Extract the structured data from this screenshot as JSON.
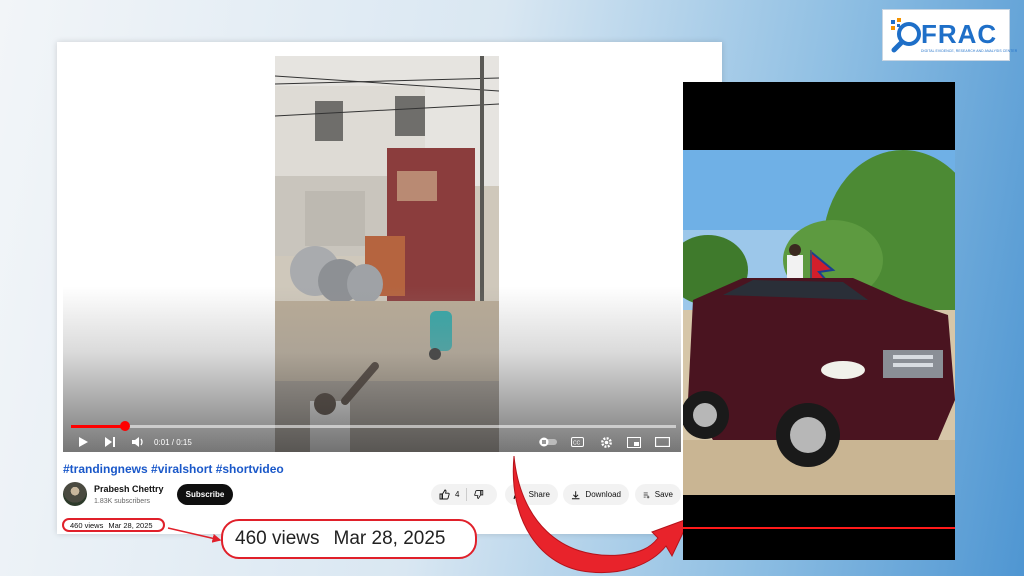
{
  "logo": {
    "text": "FRAC",
    "subtitle": "DIGITAL EVIDENCE, RESEARCH AND ANALYSIS CENTER"
  },
  "video": {
    "time": "0:01 / 0:15",
    "progress": 0.09,
    "tags": "#trandingnews #viralshort #shortvideo"
  },
  "channel": {
    "name": "Prabesh Chettry",
    "subscribers": "1.83K subscribers",
    "subscribe_label": "Subscribe"
  },
  "actions": {
    "likes": "4",
    "share_label": "Share",
    "download_label": "Download",
    "save_label": "Save"
  },
  "meta": {
    "views": "460 views",
    "date": "Mar 28, 2025"
  },
  "zoom": {
    "views": "460 views",
    "date": "Mar 28, 2025"
  },
  "colors": {
    "accent": "#e0202a",
    "link": "#1a58c9",
    "progress": "#ff0000"
  }
}
